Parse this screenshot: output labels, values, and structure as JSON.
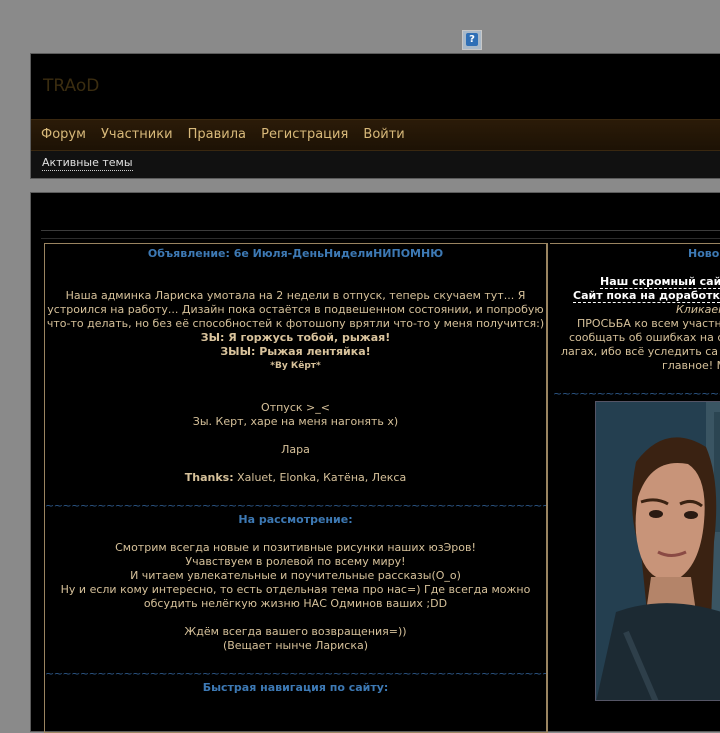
{
  "header": {
    "logo": "TRAoD",
    "nav": [
      "Форум",
      "Участники",
      "Правила",
      "Регистрация",
      "Войти"
    ],
    "active_topics": "Активные темы"
  },
  "left": {
    "title1": "Объявление: 6е Июля-ДеньНиделиНИПОМНЮ",
    "p1": [
      "Наша админка Лариска умотала на 2 недели в отпуск, теперь скучаем тут... Я",
      "устроился на работу... Дизайн пока остаётся в подвешенном состоянии, и попробую",
      "что-то делать, но без её способностей к фотошопу врятли что-то у меня получится:)"
    ],
    "zy1": "ЗЫ: Я горжусь тобой, рыжая!",
    "zy2": "ЗЫЫ: Рыжая лентяйка!",
    "by": "*By Кёрт*",
    "otpusk": "Отпуск >_<",
    "zy3": "Зы. Керт, харе на меня нагонять х)",
    "lara": "Лара",
    "thanks_label": "Thanks:",
    "thanks_names": " Xaluet, Elonka, Катёна, Лекса",
    "wave": "~~~~~~~~~~~~~~~~~~~~~~~~~~~~~~~~~~~~~~~~~~~~~~~~~~~~~~~~~~~~~~~~~~~~~~~~~~~~~~~~~~~~~~~~~~~",
    "title2": "На рассмотрение:",
    "p2": [
      "Смотрим всегда новые и позитивные рисунки наших юзЭров!",
      "Учавствуем в ролевой по всему миру!",
      "И читаем увлекательные и поучительные рассказы(O_o)",
      "Ну и если кому интересно, то есть отдельная тема про нас=) Где всегда можно",
      "обсудить нелёгкую жизню НАС Одминов ваших ;DD"
    ],
    "p3": [
      "Ждём всегда вашего возвращения=))",
      "(Вещает нынче Лариска)"
    ],
    "title3": "Быстрая навигация по сайту:"
  },
  "right": {
    "title": "Ново",
    "l1": "Наш скромный сай",
    "l2": "Сайт пока на доработк",
    "l3": "Кликаем",
    "l4": "ПРОСЬБА ко всем участн",
    "l5": "сообщать об ошибках на с",
    "l6": "лагах, ибо всё уследить са",
    "l7": "главное! М",
    "wave": "~~~~~~~~~~~~~~~~~~~~~~~~~~~~~~~~~~~~~~~~"
  }
}
